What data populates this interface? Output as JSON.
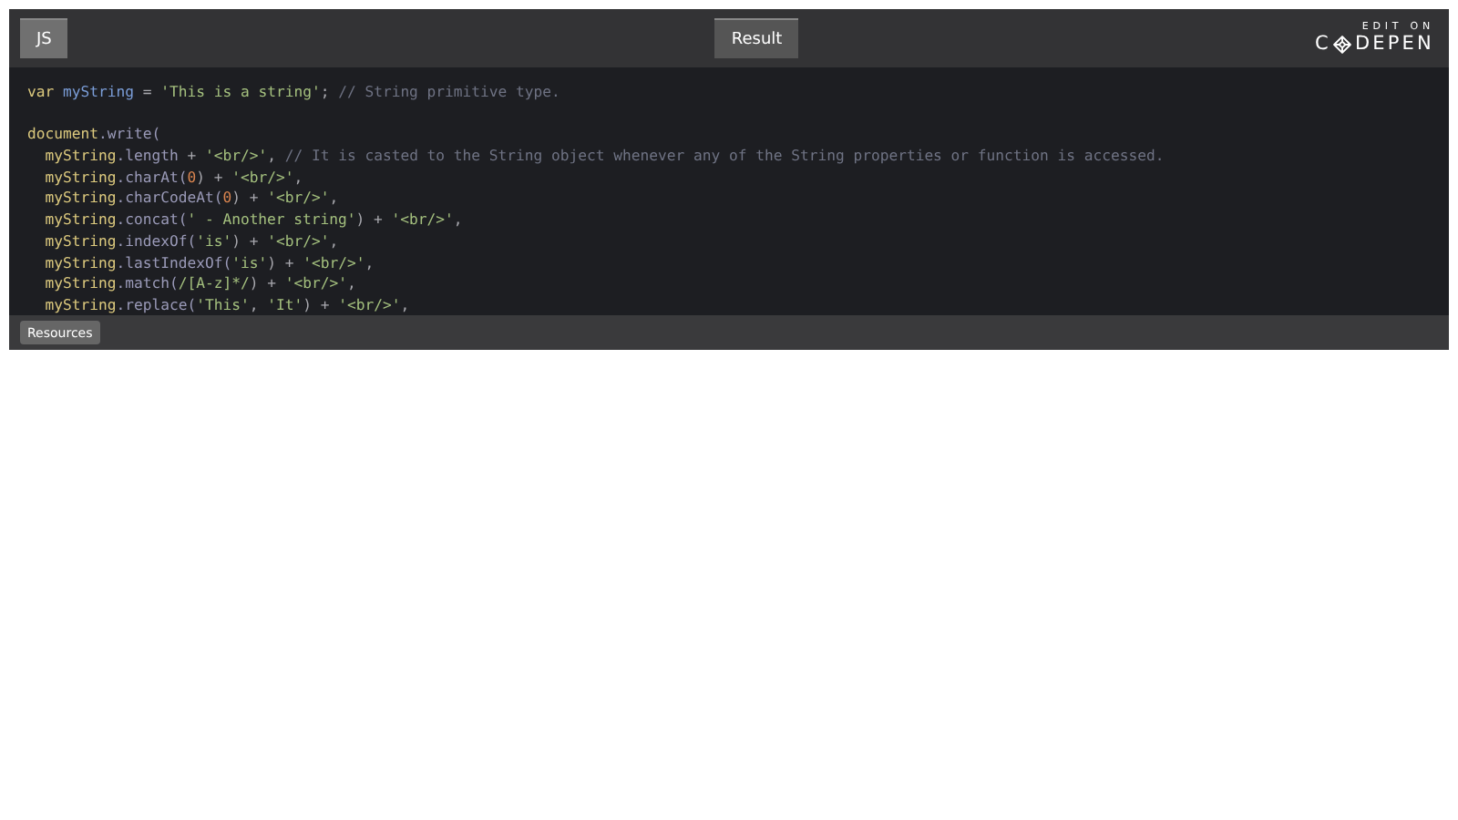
{
  "tabs": [
    {
      "label": "JS",
      "selected": true
    },
    {
      "label": "Result",
      "selected": false
    }
  ],
  "logo": {
    "edit_on": "EDIT ON",
    "left": "C",
    "right": "DEPEN"
  },
  "code_blocks": [
    [
      {
        "indented": false,
        "tokens": [
          {
            "kind": "keyword",
            "text": "var "
          },
          {
            "kind": "variable",
            "text": "myString"
          },
          {
            "kind": "plain",
            "text": " = "
          },
          {
            "kind": "string",
            "text": "'This is a string'"
          },
          {
            "kind": "plain",
            "text": "; "
          },
          {
            "kind": "comment",
            "text": "// String primitive type."
          }
        ]
      }
    ],
    [
      {
        "indented": false,
        "tokens": [
          {
            "kind": "object",
            "text": "document"
          },
          {
            "kind": "method",
            "text": ".write("
          }
        ]
      },
      {
        "indented": true,
        "tokens": [
          {
            "kind": "object",
            "text": "myString"
          },
          {
            "kind": "method",
            "text": ".length"
          },
          {
            "kind": "plain",
            "text": " + "
          },
          {
            "kind": "string",
            "text": "'<br/>'"
          },
          {
            "kind": "plain",
            "text": ", "
          },
          {
            "kind": "comment",
            "text": "// It is casted to the String object whenever any of the String properties or function is accessed."
          }
        ]
      },
      {
        "indented": true,
        "tokens": [
          {
            "kind": "object",
            "text": "myString"
          },
          {
            "kind": "method",
            "text": ".charAt("
          },
          {
            "kind": "number",
            "text": "0"
          },
          {
            "kind": "plain",
            "text": ") + "
          },
          {
            "kind": "string",
            "text": "'<br/>'"
          },
          {
            "kind": "plain",
            "text": ","
          }
        ]
      },
      {
        "indented": true,
        "tokens": [
          {
            "kind": "object",
            "text": "myString"
          },
          {
            "kind": "method",
            "text": ".charCodeAt("
          },
          {
            "kind": "number",
            "text": "0"
          },
          {
            "kind": "plain",
            "text": ") + "
          },
          {
            "kind": "string",
            "text": "'<br/>'"
          },
          {
            "kind": "plain",
            "text": ","
          }
        ]
      },
      {
        "indented": true,
        "tokens": [
          {
            "kind": "object",
            "text": "myString"
          },
          {
            "kind": "method",
            "text": ".concat("
          },
          {
            "kind": "string",
            "text": "' - Another string'"
          },
          {
            "kind": "plain",
            "text": ") + "
          },
          {
            "kind": "string",
            "text": "'<br/>'"
          },
          {
            "kind": "plain",
            "text": ","
          }
        ]
      },
      {
        "indented": true,
        "tokens": [
          {
            "kind": "object",
            "text": "myString"
          },
          {
            "kind": "method",
            "text": ".indexOf("
          },
          {
            "kind": "string",
            "text": "'is'"
          },
          {
            "kind": "plain",
            "text": ") + "
          },
          {
            "kind": "string",
            "text": "'<br/>'"
          },
          {
            "kind": "plain",
            "text": ","
          }
        ]
      },
      {
        "indented": true,
        "tokens": [
          {
            "kind": "object",
            "text": "myString"
          },
          {
            "kind": "method",
            "text": ".lastIndexOf("
          },
          {
            "kind": "string",
            "text": "'is'"
          },
          {
            "kind": "plain",
            "text": ") + "
          },
          {
            "kind": "string",
            "text": "'<br/>'"
          },
          {
            "kind": "plain",
            "text": ","
          }
        ]
      },
      {
        "indented": true,
        "tokens": [
          {
            "kind": "object",
            "text": "myString"
          },
          {
            "kind": "method",
            "text": ".match("
          },
          {
            "kind": "string",
            "text": "/[A-z]*/"
          },
          {
            "kind": "plain",
            "text": ") + "
          },
          {
            "kind": "string",
            "text": "'<br/>'"
          },
          {
            "kind": "plain",
            "text": ","
          }
        ]
      },
      {
        "indented": true,
        "tokens": [
          {
            "kind": "object",
            "text": "myString"
          },
          {
            "kind": "method",
            "text": ".replace("
          },
          {
            "kind": "string",
            "text": "'This'"
          },
          {
            "kind": "plain",
            "text": ", "
          },
          {
            "kind": "string",
            "text": "'It'"
          },
          {
            "kind": "plain",
            "text": ") + "
          },
          {
            "kind": "string",
            "text": "'<br/>'"
          },
          {
            "kind": "plain",
            "text": ","
          }
        ]
      }
    ]
  ],
  "footer": {
    "button": "Resources"
  }
}
